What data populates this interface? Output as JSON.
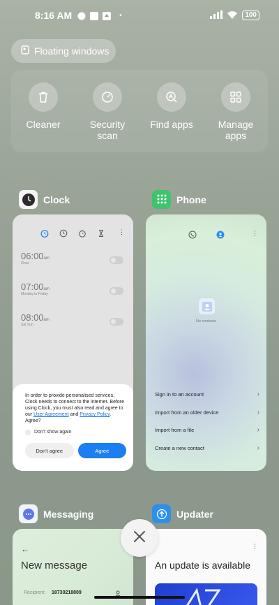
{
  "status_bar": {
    "time": "8:16 AM",
    "battery": "100"
  },
  "floating_windows": {
    "label": "Floating windows"
  },
  "quick_tools": [
    {
      "label": "Cleaner",
      "icon": "trash-icon"
    },
    {
      "label": "Security scan",
      "icon": "gauge-icon"
    },
    {
      "label": "Find apps",
      "icon": "app-search-icon"
    },
    {
      "label": "Manage apps",
      "icon": "grid-icon"
    }
  ],
  "apps": {
    "clock": {
      "name": "Clock",
      "alarms": [
        {
          "time": "06:00",
          "ampm": "am",
          "repeat": "Once"
        },
        {
          "time": "07:00",
          "ampm": "am",
          "repeat": "Monday to Friday"
        },
        {
          "time": "08:00",
          "ampm": "am",
          "repeat": "Sat Sun"
        }
      ],
      "consent": {
        "text_before": "In order to provide personalised services, Clock needs to connect to the internet. Before using Clock, you must also read and agree to our ",
        "link_user_agreement": "User Agreement",
        "and": " and ",
        "link_privacy": "Privacy Policy",
        "text_after": ". Agree?",
        "dont_show": "Don't show again",
        "disagree": "Don't agree",
        "agree": "Agree"
      }
    },
    "phone": {
      "name": "Phone",
      "empty_text": "No contacts",
      "menu": [
        "Sign in to an account",
        "Import from an older device",
        "Import from a file",
        "Create a new contact"
      ]
    },
    "messaging": {
      "name": "Messaging",
      "title": "New message",
      "recipient_label": "Recipient:",
      "recipient_value": "18730218809"
    },
    "updater": {
      "name": "Updater",
      "title": "An update is available"
    }
  },
  "colors": {
    "agree_blue": "#1b7ff1",
    "phone_icon_green": "#3ec46d",
    "updater_icon_blue": "#2b8ff0"
  }
}
